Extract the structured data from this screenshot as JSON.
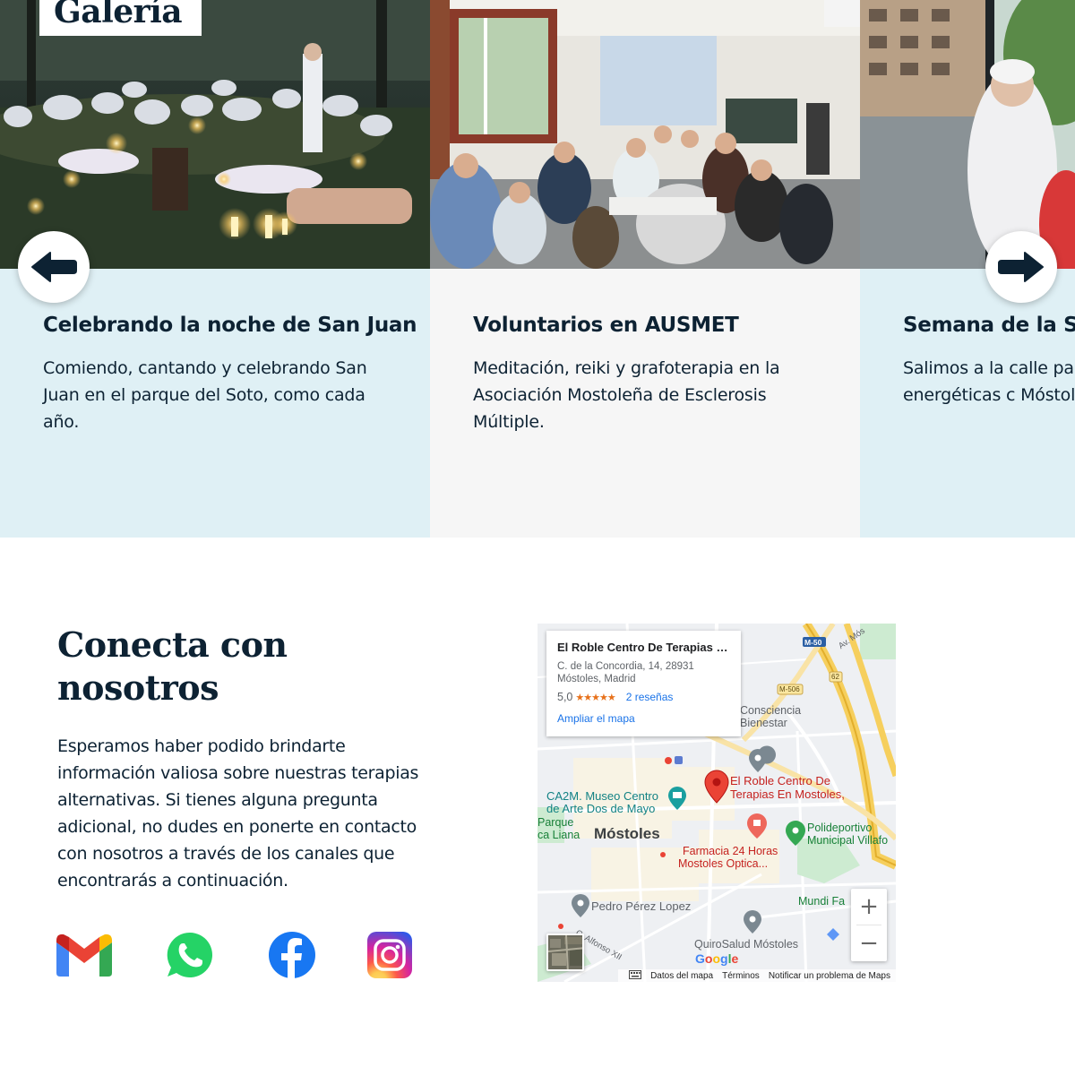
{
  "gallery": {
    "title": "Galería",
    "slides": [
      {
        "title": "Celebrando la noche de San Juan",
        "description": "Comiendo, cantando y celebrando San Juan en el parque del Soto, como cada año."
      },
      {
        "title": "Voluntarios en AUSMET",
        "description": "Meditación, reiki y grafoterapia en la Asociación Mostoleña de Esclerosis Múltiple."
      },
      {
        "title": "Semana de la Salu",
        "description": "Salimos a la calle para terapias energéticas c Móstoles."
      }
    ],
    "prev_icon": "arrow-left-icon",
    "next_icon": "arrow-right-icon"
  },
  "contact": {
    "title": "Conecta con nosotros",
    "text": "Esperamos haber podido brindarte información valiosa sobre nuestras terapias alternativas. Si tienes alguna pregunta adicional, no dudes en ponerte en contacto con nosotros a través de los canales que encontrarás a continuación.",
    "social_icons": [
      "gmail-icon",
      "whatsapp-icon",
      "facebook-icon",
      "instagram-icon"
    ]
  },
  "map": {
    "info_card": {
      "name": "El Roble Centro De Terapias E...",
      "address_line1": "C. de la Concordia, 14, 28931",
      "address_line2": "Móstoles, Madrid",
      "rating": "5,0",
      "stars": "★★★★★",
      "reviews": "2 reseñas",
      "enlarge": "Ampliar el mapa"
    },
    "labels": {
      "consciencia": "Consciencia",
      "bienestar": "Bienestar",
      "el_roble_1": "El Roble Centro De",
      "el_roble_2": "Terapias En Mostoles,",
      "ca2m_1": "CA2M. Museo Centro",
      "ca2m_2": "de Arte Dos de Mayo",
      "parque": "Parque",
      "liana": "ca Liana",
      "mostoles": "Móstoles",
      "polideportivo_1": "Polideportivo",
      "polideportivo_2": "Municipal Villafo",
      "farmacia_1": "Farmacia 24 Horas",
      "farmacia_2": "Mostoles Optica...",
      "pedro": "Pedro Pérez Lopez",
      "mundi": "Mundi Fa",
      "quirosalud": "QuiroSalud Móstoles",
      "alfonso": "C. Alfonso XII",
      "m50": "M-50",
      "m506": "M-506",
      "r62": "62",
      "av": "Av. Mós",
      "google": "Google"
    },
    "zoom_in": "+",
    "zoom_out": "−",
    "footer": {
      "keyboard_icon": "keyboard-icon",
      "data": "Datos del mapa",
      "terms": "Términos",
      "report": "Notificar un problema de Maps"
    },
    "colors": {
      "pin": "#ea4335",
      "grey_pin": "#7b8891",
      "green_pin": "#34a853",
      "link": "#1a73e8"
    }
  }
}
